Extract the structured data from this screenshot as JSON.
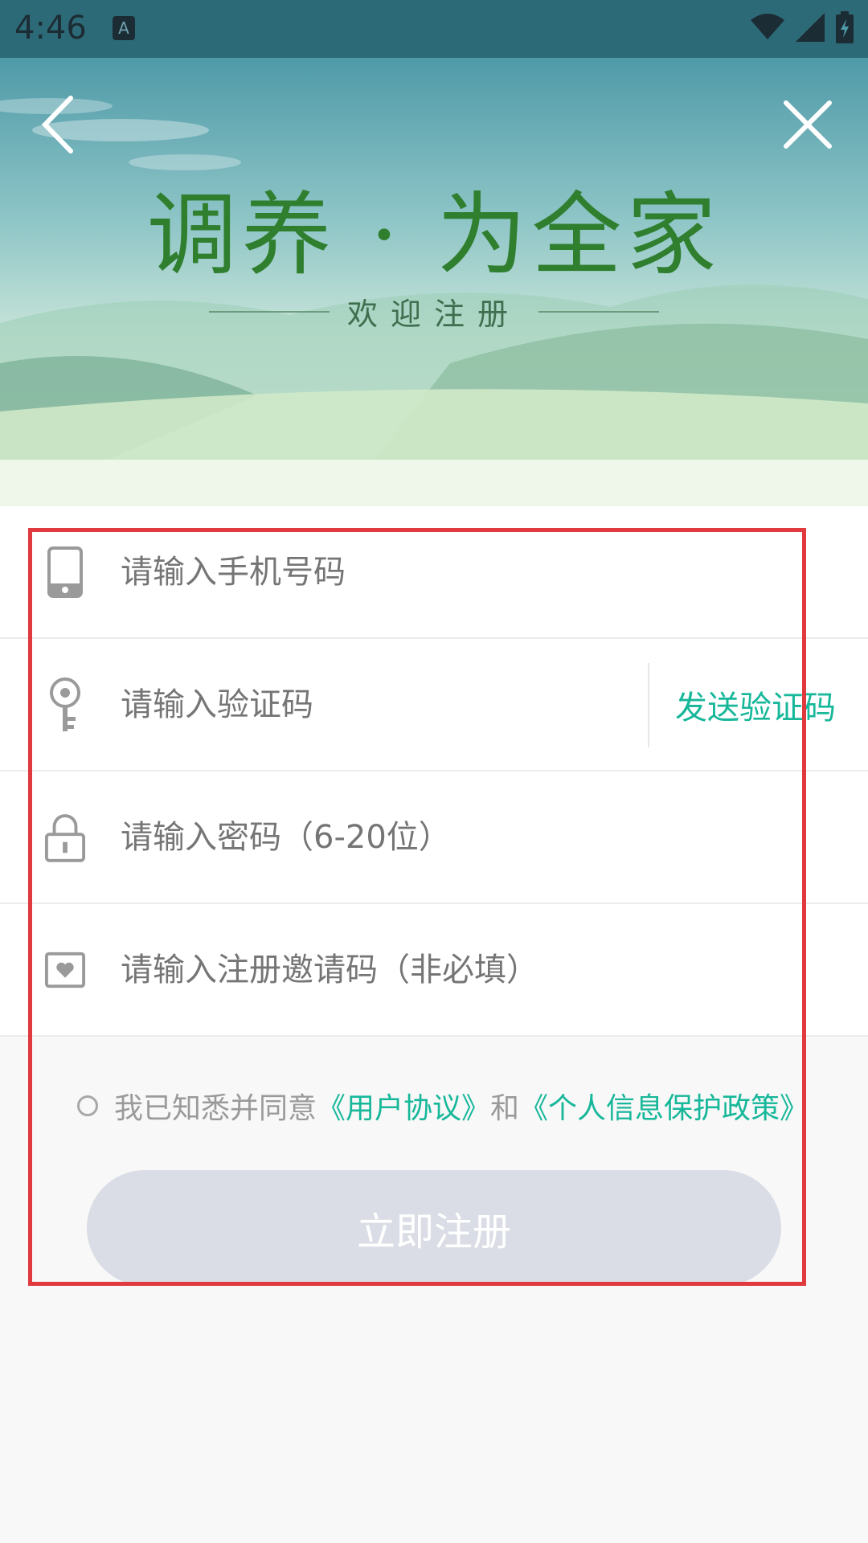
{
  "status_bar": {
    "time": "4:46",
    "notification_icon": "a-icon"
  },
  "header": {
    "slogan": "调养 · 为全家",
    "subtitle": "欢迎注册",
    "back_icon": "chevron-left-icon",
    "close_icon": "close-icon"
  },
  "form": {
    "phone": {
      "placeholder": "请输入手机号码",
      "icon": "phone-icon"
    },
    "code": {
      "placeholder": "请输入验证码",
      "icon": "key-icon",
      "send_label": "发送验证码"
    },
    "password": {
      "placeholder": "请输入密码（6-20位）",
      "icon": "lock-icon"
    },
    "invite": {
      "placeholder": "请输入注册邀请码（非必填）",
      "icon": "ticket-icon"
    }
  },
  "agreement": {
    "prefix": "我已知悉并同意",
    "user_agreement": "《用户协议》",
    "conjunction": "和",
    "privacy_policy": "《个人信息保护政策》"
  },
  "register_button": {
    "label": "立即注册"
  },
  "colors": {
    "accent": "#17b79a",
    "slogan": "#2f7f2f",
    "button_disabled": "#dadde5",
    "highlight_box": "#e0393e"
  }
}
